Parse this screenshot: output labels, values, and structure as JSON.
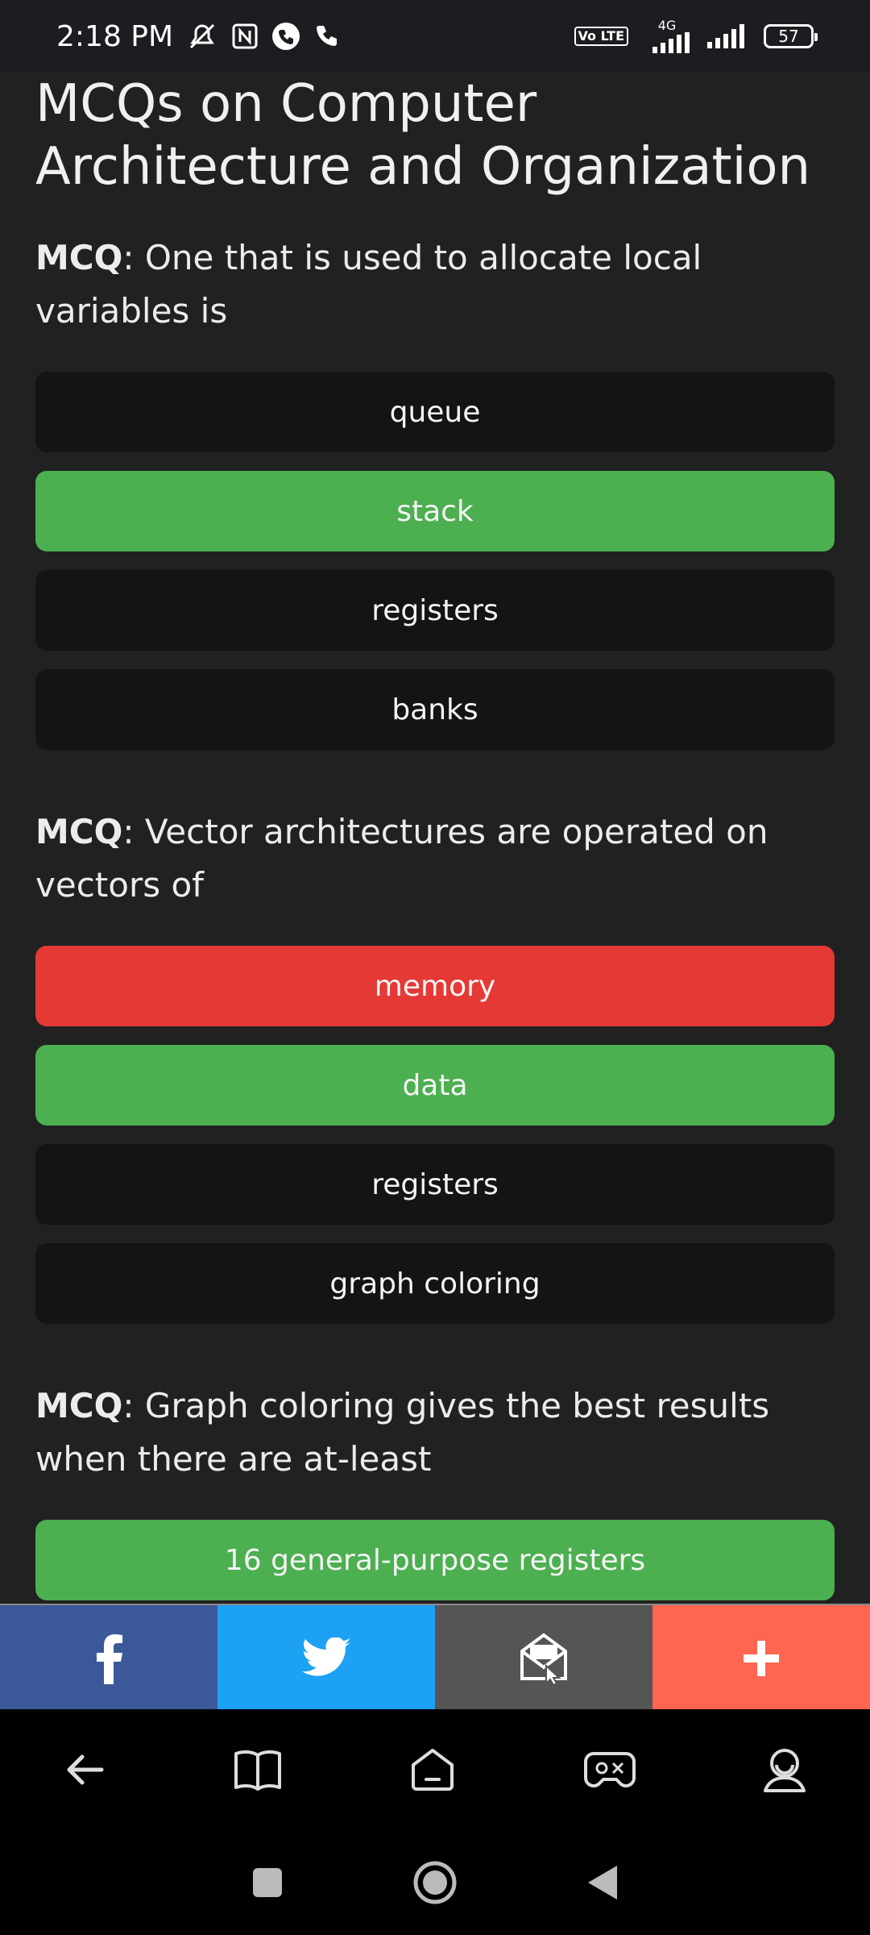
{
  "status_bar": {
    "time": "2:18 PM",
    "network": "4G",
    "volte": "Vo LTE",
    "battery": "57",
    "icons": [
      "mute-icon",
      "nfc-icon",
      "call-icon",
      "phone-icon",
      "signal-icon",
      "signal-icon"
    ]
  },
  "page": {
    "title": "MCQs on Computer Architecture and Organization",
    "mcq_prefix": "MCQ"
  },
  "questions": [
    {
      "text": ": One that is used to allocate local variables is",
      "options": [
        {
          "label": "queue",
          "state": "neutral"
        },
        {
          "label": "stack",
          "state": "correct"
        },
        {
          "label": "registers",
          "state": "neutral"
        },
        {
          "label": "banks",
          "state": "neutral"
        }
      ]
    },
    {
      "text": ": Vector architectures are operated on vectors of",
      "options": [
        {
          "label": "memory",
          "state": "wrong"
        },
        {
          "label": "data",
          "state": "correct"
        },
        {
          "label": "registers",
          "state": "neutral"
        },
        {
          "label": "graph coloring",
          "state": "neutral"
        }
      ]
    },
    {
      "text": ": Graph coloring gives the best results when there are at-least",
      "options": [
        {
          "label": "16 general-purpose registers",
          "state": "correct"
        }
      ]
    }
  ],
  "share_bar": {
    "buttons": [
      {
        "icon": "facebook-icon",
        "color": "#3b5998"
      },
      {
        "icon": "twitter-icon",
        "color": "#1da1f2"
      },
      {
        "icon": "email-icon",
        "color": "#555555"
      },
      {
        "icon": "plus-icon",
        "color": "#ff6550"
      }
    ]
  },
  "app_nav": {
    "icons": [
      "back-arrow-icon",
      "book-icon",
      "home-icon",
      "gamepad-icon",
      "profile-icon"
    ]
  },
  "system_nav": {
    "icons": [
      "recents-square-icon",
      "home-circle-icon",
      "back-triangle-icon"
    ]
  },
  "colors": {
    "background": "#212121",
    "option_neutral": "#141414",
    "option_correct": "#4caf50",
    "option_wrong": "#e53935"
  }
}
